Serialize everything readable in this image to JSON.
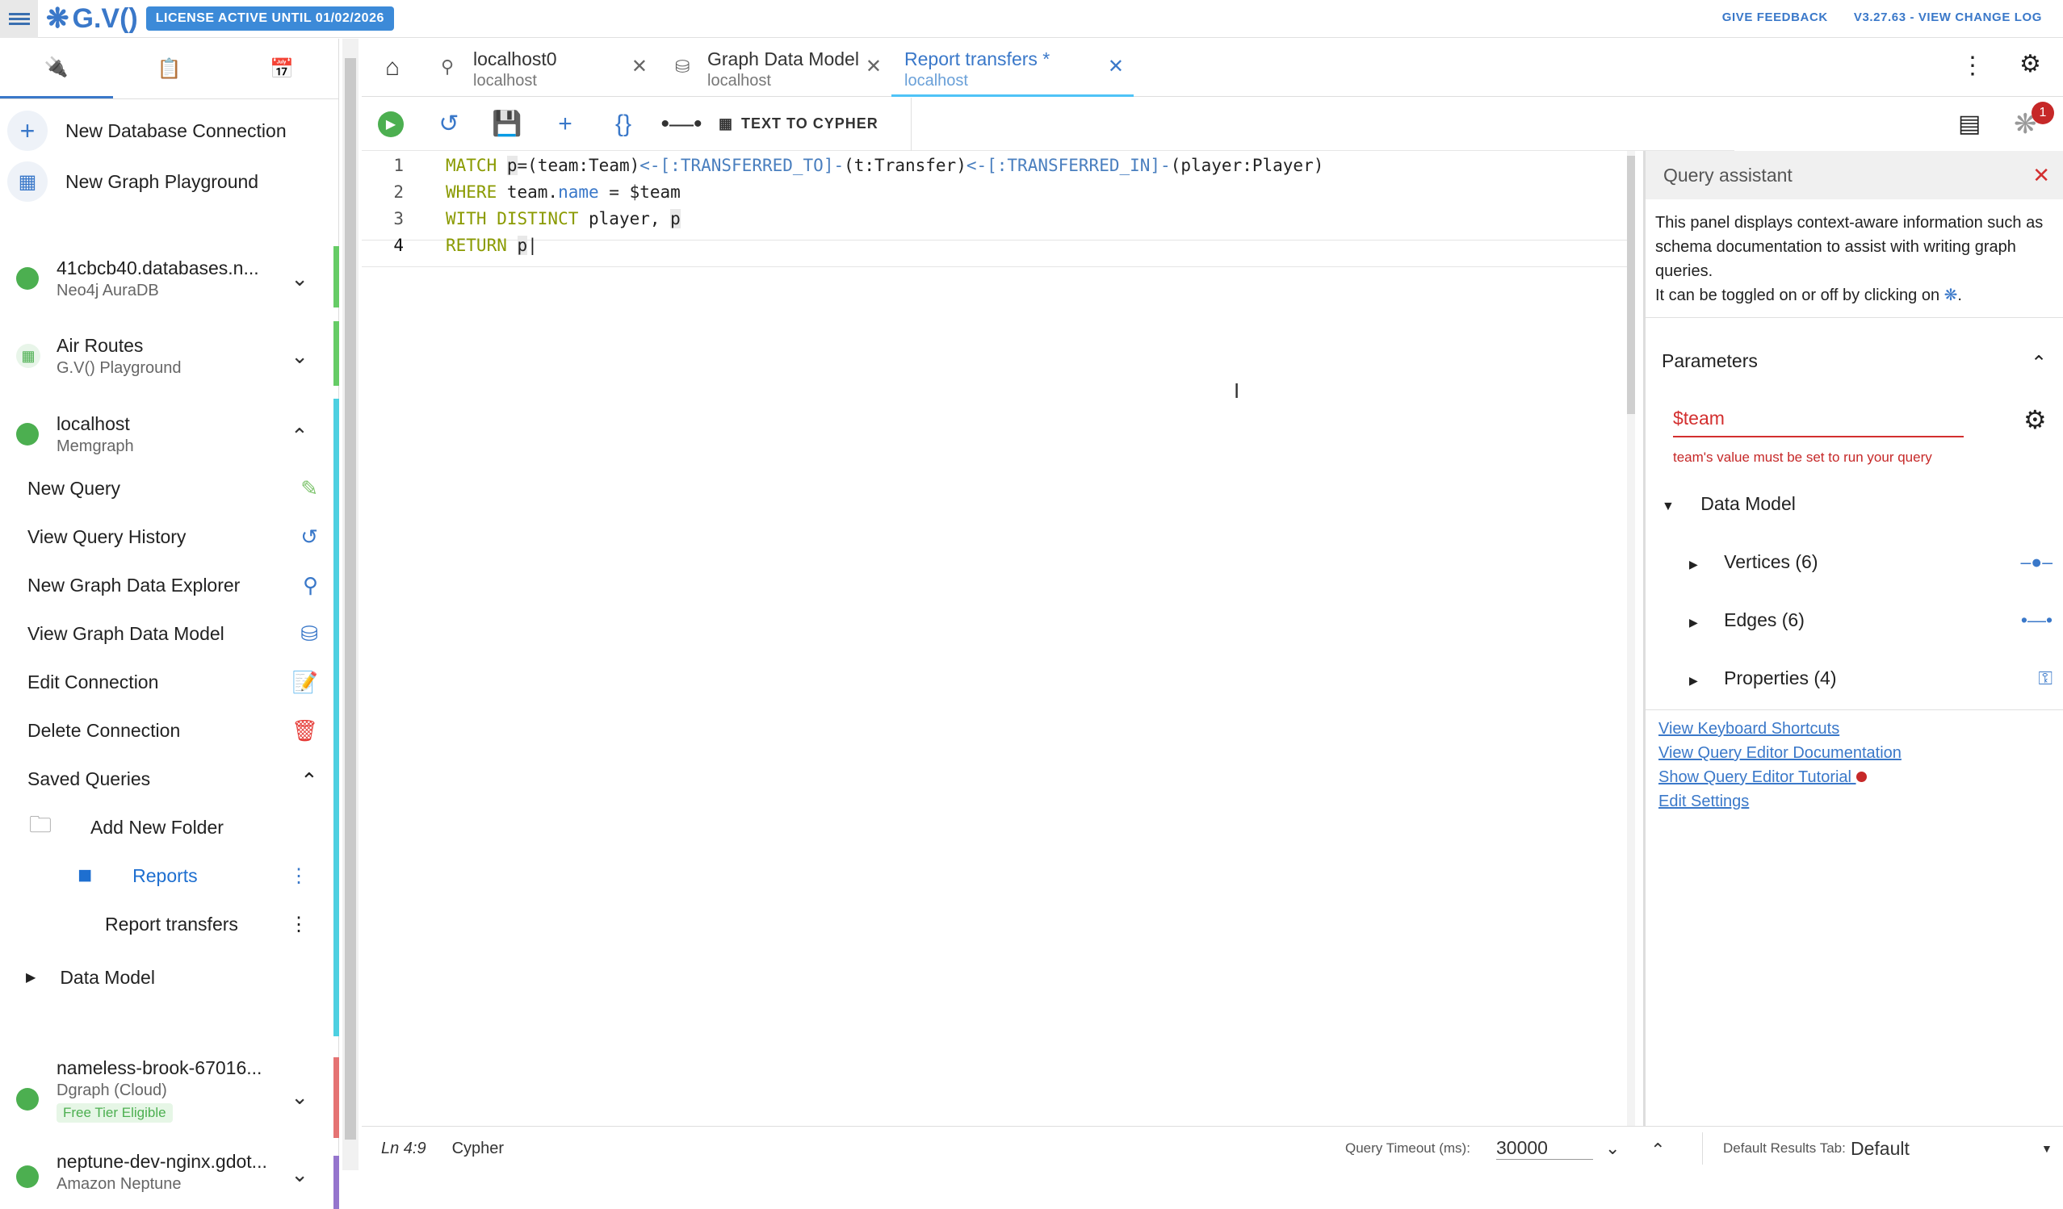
{
  "topbar": {
    "logo": "G.V()",
    "license": "LICENSE ACTIVE UNTIL 01/02/2026",
    "feedback": "GIVE FEEDBACK",
    "version": "V3.27.63 - VIEW CHANGE LOG"
  },
  "sidebar": {
    "new_connection": "New Database Connection",
    "new_playground": "New Graph Playground",
    "connections": [
      {
        "title": "41cbcb40.databases.n...",
        "sub": "Neo4j AuraDB"
      },
      {
        "title": "Air Routes",
        "sub": "G.V() Playground"
      },
      {
        "title": "localhost",
        "sub": "Memgraph"
      },
      {
        "title": "nameless-brook-67016...",
        "sub": "Dgraph (Cloud)",
        "tag": "Free Tier Eligible"
      },
      {
        "title": "neptune-dev-nginx.gdot...",
        "sub": "Amazon Neptune"
      }
    ],
    "menu": {
      "new_query": "New Query",
      "history": "View Query History",
      "explorer": "New Graph Data Explorer",
      "data_model": "View Graph Data Model",
      "edit": "Edit Connection",
      "delete": "Delete Connection",
      "saved": "Saved Queries",
      "add_folder": "Add New Folder",
      "reports": "Reports",
      "report_transfers": "Report transfers",
      "dm": "Data Model"
    }
  },
  "tabs": [
    {
      "title": "localhost0",
      "sub": "localhost"
    },
    {
      "title": "Graph Data Model",
      "sub": "localhost"
    },
    {
      "title": "Report transfers *",
      "sub": "localhost"
    }
  ],
  "toolbar": {
    "text_to_cypher": "TEXT TO CYPHER",
    "notif_count": "1"
  },
  "editor": {
    "lines": [
      "1",
      "2",
      "3",
      "4"
    ]
  },
  "assistant": {
    "title": "Query assistant",
    "desc1": "This panel displays context-aware information such as schema documentation to assist with writing graph queries.",
    "desc2": "It can be toggled on or off by clicking on",
    "params_title": "Parameters",
    "param_name": "$team",
    "param_error": "team's value must be set to run your query",
    "dm_title": "Data Model",
    "vertices": "Vertices (6)",
    "edges": "Edges (6)",
    "properties": "Properties (4)",
    "link1": "View Keyboard Shortcuts",
    "link2": "View Query Editor Documentation",
    "link3": "Show Query Editor Tutorial",
    "link4": "Edit Settings"
  },
  "status": {
    "pos": "Ln 4:9",
    "lang": "Cypher",
    "timeout_label": "Query Timeout (ms):",
    "timeout": "30000",
    "results_label": "Default Results Tab:",
    "results": "Default"
  }
}
